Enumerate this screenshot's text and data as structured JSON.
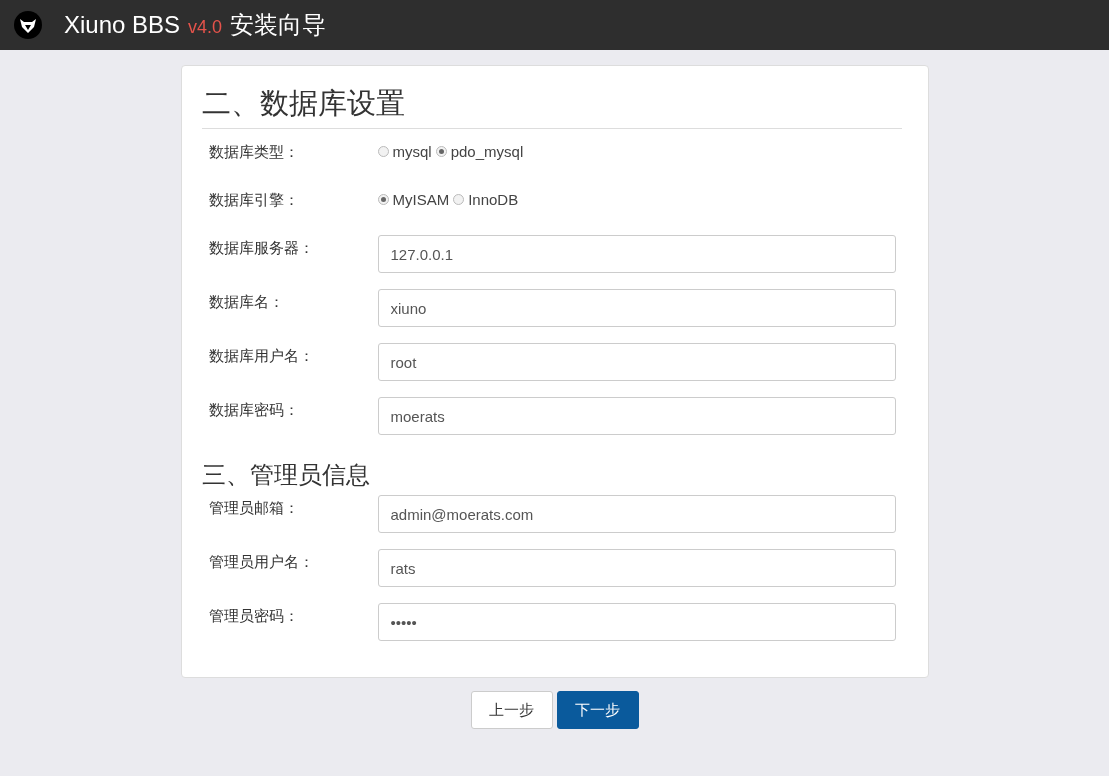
{
  "header": {
    "title": "Xiuno BBS",
    "version": "v4.0",
    "subtitle": "安装向导"
  },
  "sections": [
    {
      "title": "二、数据库设置",
      "large": true,
      "fields": [
        {
          "kind": "radio",
          "label": "数据库类型：",
          "options": [
            {
              "label": "mysql",
              "selected": false
            },
            {
              "label": "pdo_mysql",
              "selected": true
            }
          ]
        },
        {
          "kind": "radio",
          "label": "数据库引擎：",
          "options": [
            {
              "label": "MyISAM",
              "selected": true
            },
            {
              "label": "InnoDB",
              "selected": false
            }
          ]
        },
        {
          "kind": "text",
          "label": "数据库服务器：",
          "value": "127.0.0.1"
        },
        {
          "kind": "text",
          "label": "数据库名：",
          "value": "xiuno"
        },
        {
          "kind": "text",
          "label": "数据库用户名：",
          "value": "root"
        },
        {
          "kind": "text",
          "label": "数据库密码：",
          "value": "moerats"
        }
      ]
    },
    {
      "title": "三、管理员信息",
      "large": false,
      "fields": [
        {
          "kind": "text",
          "label": "管理员邮箱：",
          "value": "admin@moerats.com"
        },
        {
          "kind": "text",
          "label": "管理员用户名：",
          "value": "rats"
        },
        {
          "kind": "text",
          "label": "管理员密码：",
          "value": "•••••"
        }
      ]
    }
  ],
  "buttons": [
    {
      "label": "上一步",
      "primary": false
    },
    {
      "label": "下一步",
      "primary": true
    }
  ]
}
